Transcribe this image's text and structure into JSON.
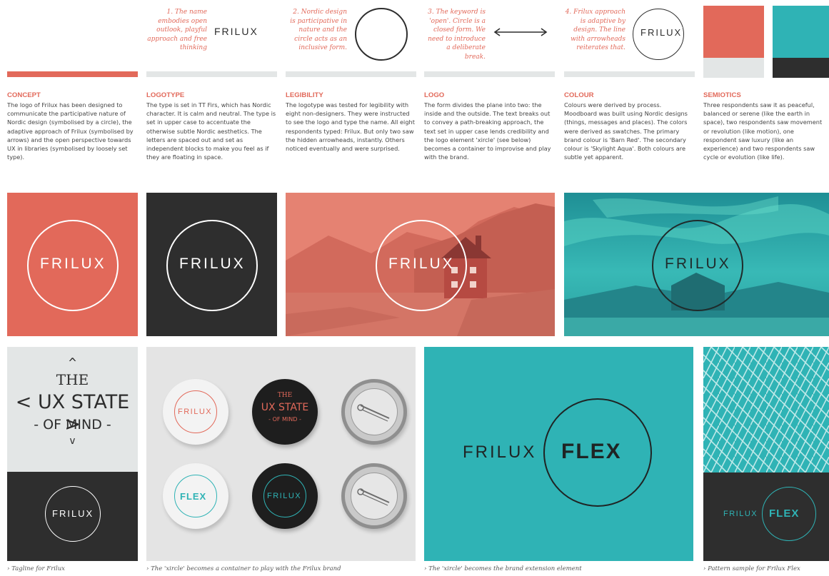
{
  "notes": [
    "1. The name embodies open outlook, playful approach and free thinking",
    "2. Nordic design is participative in nature and the circle acts as an inclusive form.",
    "3. The keyword is 'open'. Circle is a closed form. We need to introduce a deliberate break.",
    "4. Frilux approach is adaptive by design. The line with arrowheads reiterates that."
  ],
  "brand": {
    "name": "FRILUX",
    "flex": "FLEX"
  },
  "sections": [
    {
      "title": "CONCEPT",
      "body": "The logo of Frilux has been designed to communicate the participative nature of Nordic design (symbolised by a circle), the adaptive approach of Frilux (symbolised by arrows) and the open perspective towards UX in libraries (symbolised by loosely set type)."
    },
    {
      "title": "LOGOTYPE",
      "body": "The type is set in TT Firs, which has Nordic character. It is calm and neutral. The type is set in upper case to accentuate the otherwise subtle Nordic aesthetics. The letters are spaced out and set as independent blocks to make you feel as if they are floating in space."
    },
    {
      "title": "LEGIBILITY",
      "body": "The logotype was tested for legibility with eight non-designers. They were instructed to see the logo and type the name. All eight respondents typed: Frilux. But only two saw the hidden arrowheads, instantly. Others noticed eventually and were surprised."
    },
    {
      "title": "LOGO",
      "body": "The form divides the plane into two: the inside and the outside. The text breaks out to convey a path-breaking approach, the text set in upper case lends credibility and the logo element 'xircle' (see below) becomes a container to improvise and play with the brand."
    },
    {
      "title": "COLOUR",
      "body": "Colours were derived by process. Moodboard was built using Nordic designs (things, messages and places). The colors were derived as swatches. The primary brand colour is 'Barn Red'. The secondary colour is 'Skylight Aqua'. Both colours are subtle yet apparent."
    },
    {
      "title": "SEMIOTICS",
      "body": "Three respondents saw it as peaceful, balanced or serene (like the earth in space), two respondents saw movement or revolution (like motion), one respondent saw luxury (like an experience) and two respondents saw cycle or evolution (like life)."
    }
  ],
  "tagline": {
    "the": "THE",
    "line1": "< UX STATE >",
    "line2": "- OF MIND -"
  },
  "badge_tagline": {
    "the": "THE",
    "line1": "UX STATE",
    "line2": "- OF MIND -"
  },
  "captions": [
    "› Tagline for Frilux",
    "› The 'xircle' becomes a container to play with the Frilux brand",
    "› The 'xircle' becomes the brand extension element",
    "› Pattern sample for Frilux Flex"
  ],
  "colors": {
    "barn_red": "#e2695a",
    "skylight_aqua": "#2fb3b5",
    "dark": "#2e2e2e",
    "light_gray": "#e3e6e6"
  }
}
